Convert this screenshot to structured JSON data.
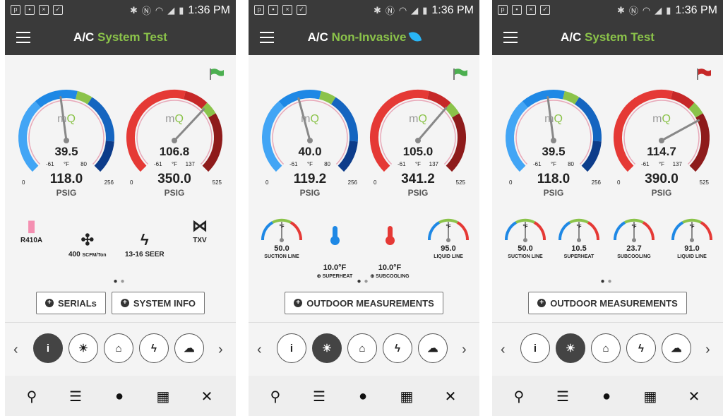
{
  "colors": {
    "accent": "#8bc34a",
    "low_blue": "#1565c0",
    "high_red": "#c62828",
    "needle_blue": "#29b6f6",
    "bar": "#3a3a3a"
  },
  "status": {
    "time": "1:36 PM"
  },
  "screens": [
    {
      "title_prefix": "A/C ",
      "title_accent": "System Test",
      "flag": "green-flag-icon",
      "low": {
        "temp": "39.5",
        "unit": "°F",
        "min": "-61",
        "max": "80",
        "pressure": "118.0",
        "punit": "PSIG",
        "lo": "0",
        "hi": "256",
        "needle": 0.47
      },
      "high": {
        "temp": "106.8",
        "unit": "°F",
        "min": "-61",
        "max": "137",
        "pressure": "350.0",
        "punit": "PSIG",
        "lo": "0",
        "hi": "525",
        "needle": 0.67
      },
      "info": [
        {
          "label": "R410A",
          "icon": "refrigerant-tank-icon"
        },
        {
          "label": "400",
          "sub": "SCFM/Ton",
          "icon": "fan-icon"
        },
        {
          "label": "13-16 SEER",
          "icon": "lightning-icon"
        },
        {
          "label": "TXV",
          "icon": "valve-icon"
        }
      ],
      "buttons": [
        "SERIALs",
        "SYSTEM INFO"
      ]
    },
    {
      "title_prefix": "A/C ",
      "title_accent": "Non-Invasive",
      "flag": "green-flag-icon",
      "low": {
        "temp": "40.0",
        "unit": "°F",
        "min": "-61",
        "max": "80",
        "pressure": "119.2",
        "punit": "PSIG",
        "lo": "0",
        "hi": "256",
        "needle": 0.44
      },
      "high": {
        "temp": "105.0",
        "unit": "°F",
        "min": "-61",
        "max": "137",
        "pressure": "341.2",
        "punit": "PSIG",
        "lo": "0",
        "hi": "525",
        "needle": 0.66
      },
      "mini": [
        {
          "value": "50.0",
          "label": "SUCTION LINE",
          "deg": "°F"
        },
        {
          "value": "10.0°F",
          "label": "SUPERHEAT"
        },
        {
          "value": "10.0°F",
          "label": "SUBCOOLING"
        },
        {
          "value": "95.0",
          "label": "LIQUID LINE",
          "deg": "°F"
        }
      ],
      "buttons": [
        "OUTDOOR MEASUREMENTS"
      ]
    },
    {
      "title_prefix": "A/C ",
      "title_accent": "System Test",
      "flag": "red-flag-icon",
      "low": {
        "temp": "39.5",
        "unit": "°F",
        "min": "-61",
        "max": "80",
        "pressure": "118.0",
        "punit": "PSIG",
        "lo": "0",
        "hi": "256",
        "needle": 0.47
      },
      "high": {
        "temp": "114.7",
        "unit": "°F",
        "min": "-61",
        "max": "137",
        "pressure": "390.0",
        "punit": "PSIG",
        "lo": "0",
        "hi": "525",
        "needle": 0.74
      },
      "mini": [
        {
          "value": "50.0",
          "label": "SUCTION LINE",
          "deg": "°F"
        },
        {
          "value": "10.5",
          "label": "SUPERHEAT",
          "deg": "°F"
        },
        {
          "value": "23.7",
          "label": "SUBCOOLING",
          "deg": "°F"
        },
        {
          "value": "91.0",
          "label": "LIQUID LINE",
          "deg": "°F"
        }
      ],
      "buttons": [
        "OUTDOOR MEASUREMENTS"
      ]
    }
  ],
  "nav": {
    "info_label": "i"
  }
}
